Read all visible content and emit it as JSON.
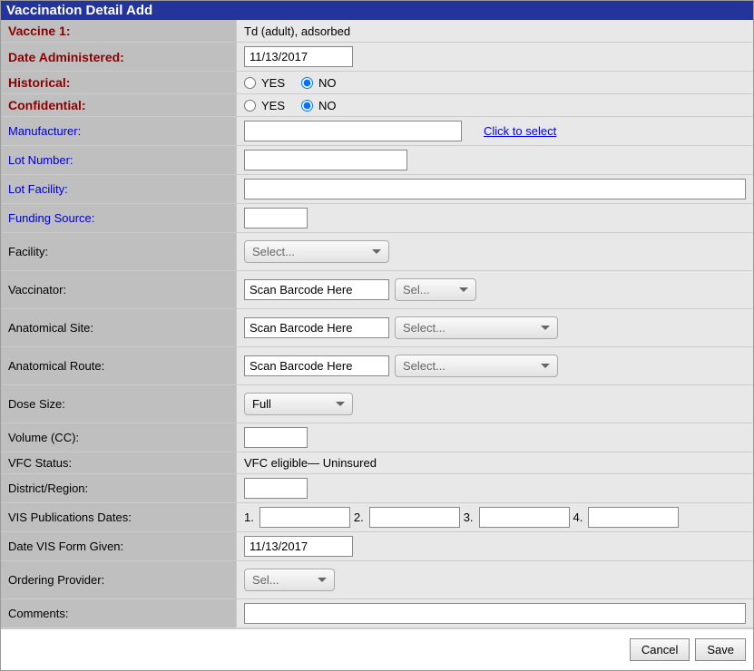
{
  "header": {
    "title": "Vaccination Detail Add"
  },
  "labels": {
    "vaccine1": "Vaccine 1:",
    "date_admin": "Date Administered:",
    "historical": "Historical:",
    "confidential": "Confidential:",
    "manufacturer": "Manufacturer:",
    "lot_number": "Lot Number:",
    "lot_facility": "Lot Facility:",
    "funding_source": "Funding Source:",
    "facility": "Facility:",
    "vaccinator": "Vaccinator:",
    "anatomical_site": "Anatomical Site:",
    "anatomical_route": "Anatomical Route:",
    "dose_size": "Dose Size:",
    "volume": "Volume (CC):",
    "vfc_status": "VFC Status:",
    "district_region": "District/Region:",
    "vis_pub_dates": "VIS Publications Dates:",
    "date_vis_given": "Date VIS Form Given:",
    "ordering_provider": "Ordering Provider:",
    "comments": "Comments:"
  },
  "radio": {
    "yes": "YES",
    "no": "NO"
  },
  "values": {
    "vaccine1": "Td (adult), adsorbed",
    "date_admin": "11/13/2017",
    "manufacturer": "",
    "manufacturer_link": "Click to select",
    "lot_number": "",
    "lot_facility": "",
    "funding_source": "",
    "facility_select": "Select...",
    "vaccinator_input": "Scan Barcode Here",
    "vaccinator_select": "Sel...",
    "site_input": "Scan Barcode Here",
    "site_select": "Select...",
    "route_input": "Scan Barcode Here",
    "route_select": "Select...",
    "dose_size_select": "Full",
    "volume": "",
    "vfc_status": "VFC eligible— Uninsured",
    "district_region": "",
    "vis": {
      "n1": "1.",
      "n2": "2.",
      "n3": "3.",
      "n4": "4.",
      "v1": "",
      "v2": "",
      "v3": "",
      "v4": ""
    },
    "date_vis_given": "11/13/2017",
    "ordering_provider_select": "Sel...",
    "comments": ""
  },
  "buttons": {
    "cancel": "Cancel",
    "save": "Save"
  }
}
